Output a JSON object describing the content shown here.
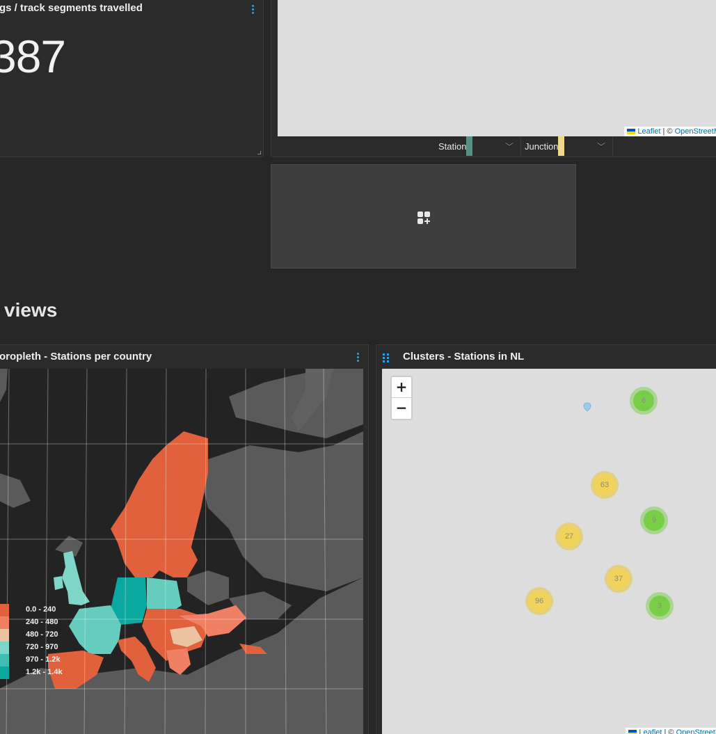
{
  "kpi": {
    "title": "gs / track segments travelled",
    "value": "387"
  },
  "top_map": {
    "attribution_leaflet": "Leaflet",
    "attribution_sep": " | © ",
    "attribution_osm": "OpenStreetM",
    "legend": [
      {
        "label": "Station",
        "color": "#5a8f84"
      },
      {
        "label": "Junction",
        "color": "#f0d98a"
      }
    ]
  },
  "add_widget": {
    "icon": "add-widget-icon"
  },
  "section": {
    "heading": "views"
  },
  "choropleth": {
    "title": "oropleth - Stations per country",
    "legend": [
      {
        "label": "0.0 - 240",
        "color": "#e0613c"
      },
      {
        "label": "240 - 480",
        "color": "#f08064"
      },
      {
        "label": "480 - 720",
        "color": "#ebc3a0"
      },
      {
        "label": "720 - 970",
        "color": "#7fd6c8"
      },
      {
        "label": "970 - 1.2k",
        "color": "#3fbdb0"
      },
      {
        "label": "1.2k - 1.4k",
        "color": "#0aa89e"
      }
    ]
  },
  "clusters": {
    "title": "Clusters - Stations in NL",
    "zoom_in": "+",
    "zoom_out": "−",
    "markers": [
      {
        "count": "6",
        "color": "green"
      },
      {
        "count": "63",
        "color": "yellow"
      },
      {
        "count": "9",
        "color": "green"
      },
      {
        "count": "27",
        "color": "yellow"
      },
      {
        "count": "37",
        "color": "yellow"
      },
      {
        "count": "96",
        "color": "yellow"
      },
      {
        "count": "3",
        "color": "green"
      }
    ],
    "attribution_leaflet": "Leaflet",
    "attribution_sep": " | © ",
    "attribution_osm": "OpenStreetM"
  }
}
